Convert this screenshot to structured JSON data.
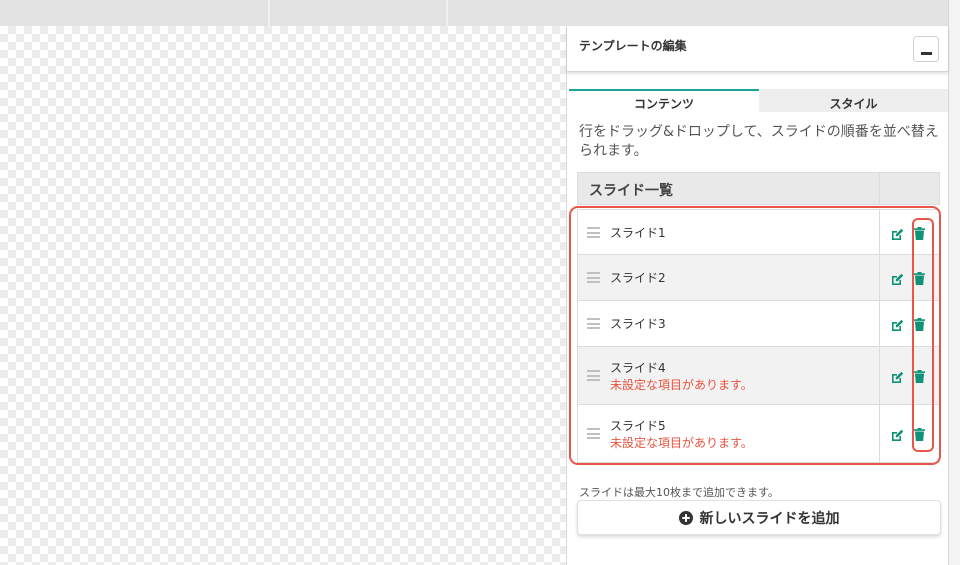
{
  "panel": {
    "title": "テンプレートの編集",
    "collapse_icon": "minus-icon"
  },
  "tabs": [
    {
      "label": "コンテンツ",
      "active": true
    },
    {
      "label": "スタイル",
      "active": false
    }
  ],
  "hint": "行をドラッグ&ドロップして、スライドの順番を並べ替えられます。",
  "slide_list": {
    "header": "スライド一覧",
    "rows": [
      {
        "name": "スライド1",
        "warning": ""
      },
      {
        "name": "スライド2",
        "warning": ""
      },
      {
        "name": "スライド3",
        "warning": ""
      },
      {
        "name": "スライド4",
        "warning": "未設定な項目があります。"
      },
      {
        "name": "スライド5",
        "warning": "未設定な項目があります。"
      }
    ]
  },
  "limit_note": "スライドは最大10枚まで追加できます。",
  "add_button": {
    "label": "新しいスライドを追加",
    "icon": "plus-circle-icon"
  },
  "colors": {
    "accent": "#1ca39b",
    "icon": "#0f9277",
    "warning": "#e8533f",
    "highlight": "#e8564a"
  }
}
